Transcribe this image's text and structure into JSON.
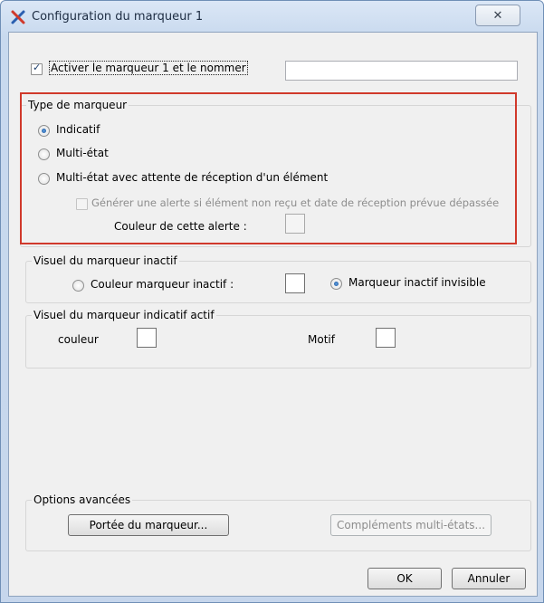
{
  "window": {
    "title": "Configuration du marqueur 1",
    "close_glyph": "✕"
  },
  "activate": {
    "checked": true,
    "label": "Activer le marqueur 1 et le nommer",
    "name_value": ""
  },
  "type_group": {
    "title": "Type de marqueur",
    "options": [
      {
        "label": "Indicatif",
        "selected": true
      },
      {
        "label": "Multi-état",
        "selected": false
      },
      {
        "label": "Multi-état avec attente de réception d'un élément",
        "selected": false
      }
    ],
    "alert_checkbox_label": "Générer une alerte si élément non reçu et date de réception prévue dépassée",
    "alert_color_label": "Couleur de cette alerte :"
  },
  "inactive_group": {
    "title": "Visuel du marqueur inactif",
    "color_option_label": "Couleur marqueur inactif :",
    "invisible_option_label": "Marqueur inactif invisible",
    "invisible_selected": true
  },
  "active_group": {
    "title": "Visuel du marqueur indicatif actif",
    "color_label": "couleur",
    "pattern_label": "Motif"
  },
  "advanced_group": {
    "title": "Options avancées",
    "scope_button": "Portée du marqueur...",
    "multistate_button": "Compléments multi-états..."
  },
  "footer": {
    "ok_label": "OK",
    "cancel_label": "Annuler"
  },
  "colors": {
    "highlight_border": "#d0392b",
    "dialog_background": "#f0f0f0"
  }
}
